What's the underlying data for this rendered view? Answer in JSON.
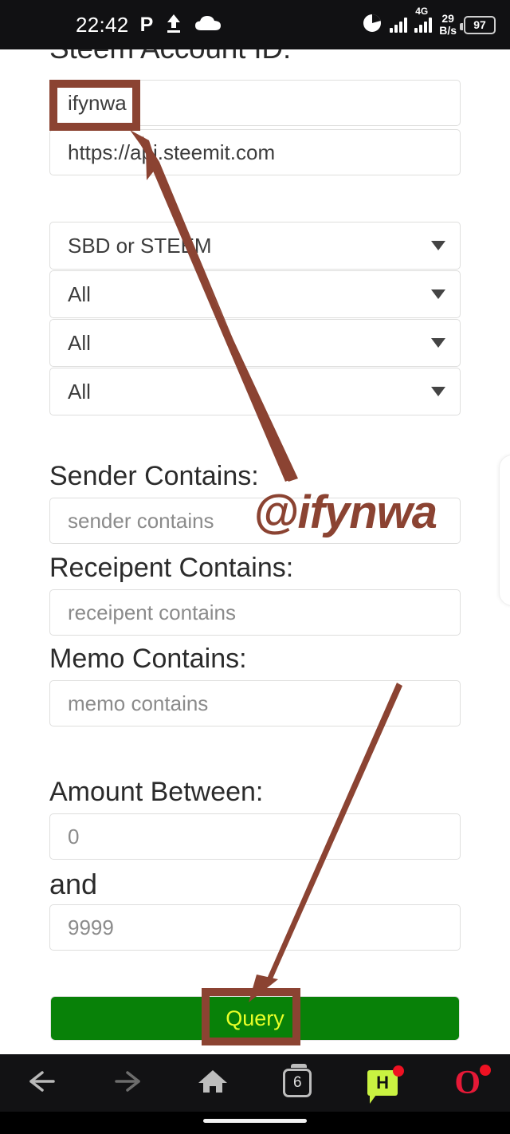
{
  "status_bar": {
    "time": "22:42",
    "p_badge": "P",
    "upload_icon": "upload-arrow-icon",
    "cloud_icon": "cloud-icon",
    "data_usage_icon": "pie-chart-icon",
    "signal_icon": "signal-bars-icon",
    "network_type": "4G",
    "net_speed_value": "29",
    "net_speed_unit": "B/s",
    "battery_level": "97"
  },
  "form": {
    "account_heading": "Steem Account ID:",
    "account_value": "ifynwa",
    "api_node_value": "https://api.steemit.com",
    "selects": [
      {
        "name": "currency-select",
        "value": "SBD or STEEM"
      },
      {
        "name": "filter-two-select",
        "value": "All"
      },
      {
        "name": "filter-three-select",
        "value": "All"
      },
      {
        "name": "filter-four-select",
        "value": "All"
      }
    ],
    "sender_label": "Sender Contains:",
    "sender_placeholder": "sender contains",
    "receipent_label": "Receipent Contains:",
    "receipent_placeholder": "receipent contains",
    "memo_label": "Memo Contains:",
    "memo_placeholder": "memo contains",
    "amount_label": "Amount Between:",
    "amount_min": "0",
    "amount_and_label": "and",
    "amount_max": "9999",
    "query_label": "Query"
  },
  "annotations": {
    "watermark": "@ifynwa",
    "highlight_color": "#8b4332",
    "arrow_color": "#8b4332"
  },
  "browser_bar": {
    "back_icon": "back-arrow-icon",
    "forward_icon": "forward-arrow-icon",
    "home_icon": "home-icon",
    "tab_count": "6",
    "chat_label": "H",
    "opera_label": "O"
  },
  "colors": {
    "query_button_bg": "#088108",
    "query_button_text": "#e8ff28",
    "status_bar_bg": "#111113",
    "browser_bar_bg": "#121214",
    "chat_badge": "#c9f241",
    "opera_red": "#e51937"
  }
}
